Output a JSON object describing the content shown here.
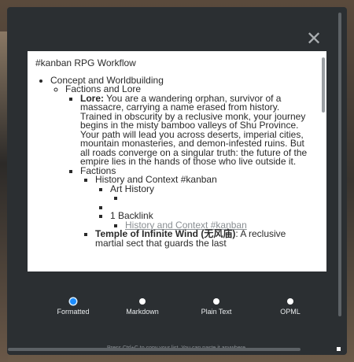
{
  "modal": {
    "close_icon": "close-icon",
    "close_glyph": "✕"
  },
  "export": {
    "title": "#kanban RPG Workflow",
    "concept": "Concept and Worldbuilding",
    "factions_lore": "Factions and Lore",
    "lore_label": "Lore:",
    "lore_text": " You are a wandering orphan, survivor of a massacre, carrying a name erased from history. Trained in obscurity by a reclusive monk, your journey begins in the misty bamboo valleys of Shu Province. Your path will lead you across deserts, imperial cities, mountain monasteries, and demon-infested ruins. But all roads converge on a singular truth: the future of the empire lies in the hands of those who live outside it.",
    "factions": "Factions",
    "history_context": "History and Context #kanban",
    "art_history": "Art History",
    "backlink_count": "1 Backlink",
    "backlink_target": "History and Context #kanban",
    "temple_label": "Temple of Infinite Wind (无风庙)",
    "temple_text": ": A reclusive martial sect that guards the last"
  },
  "formats": [
    {
      "label": "Formatted",
      "selected": true
    },
    {
      "label": "Markdown",
      "selected": false
    },
    {
      "label": "Plain Text",
      "selected": false
    },
    {
      "label": "OPML",
      "selected": false
    }
  ],
  "hint": "Press Ctrl+C to copy your list. You can paste it anywhere."
}
